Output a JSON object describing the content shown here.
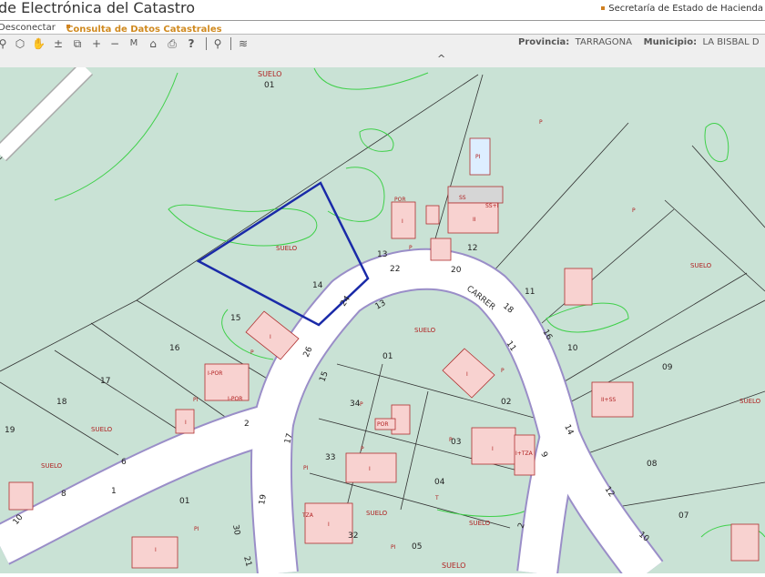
{
  "header": {
    "title": "de Electrónica del Catastro",
    "secretaria": "Secretaría de Estado de Hacienda"
  },
  "nav": {
    "disconnect": "Desconectar",
    "consulta": "Consulta de Datos Catastrales"
  },
  "toolbar": {
    "tools": [
      "zoom-icon",
      "layers-3d-icon",
      "pan-hand-icon",
      "zoom-plus-minus-icon",
      "zoom-window-icon",
      "zoom-in-icon",
      "zoom-out-icon",
      "measure-icon",
      "home-icon",
      "print-icon",
      "help-icon",
      "location-pin-icon",
      "layers-icon"
    ],
    "tool_glyphs": [
      "⚲",
      "⬡",
      "✋",
      "±",
      "⧉",
      "+",
      "−",
      "M",
      "⌂",
      "⎙",
      "?",
      "⚲",
      "≋"
    ],
    "provincia_label": "Provincia:",
    "provincia": "TARRAGONA",
    "municipio_label": "Municipio:",
    "municipio": "LA BISBAL D",
    "collapse": "^"
  },
  "map": {
    "street": "CARRER",
    "parcels": [
      "01",
      "13",
      "12",
      "14",
      "15",
      "16",
      "17",
      "18",
      "19",
      "11",
      "10",
      "09",
      "08",
      "07",
      "01",
      "34",
      "02",
      "33",
      "03",
      "04",
      "05",
      "01",
      "32"
    ],
    "suelo": [
      "SUELO",
      "SUELO",
      "SUELO",
      "SUELO",
      "SUELO",
      "SUELO",
      "SUELO",
      "SUELO",
      "SUELO",
      "SUELO"
    ],
    "house_numbers": [
      "22",
      "20",
      "24",
      "13",
      "18",
      "26",
      "15",
      "11",
      "16",
      "2",
      "6",
      "17",
      "14",
      "8",
      "1",
      "19",
      "9",
      "12",
      "30",
      "21",
      "10",
      "2",
      "10"
    ],
    "building_codes": [
      "I",
      "I",
      "I",
      "I",
      "I",
      "I",
      "I",
      "I",
      "POR",
      "POR",
      "SS",
      "SS+I",
      "II",
      "I-POR",
      "I-POR",
      "POR",
      "I+TZA",
      "II+SS",
      "TZA",
      "PI",
      "PI",
      "PI",
      "PI",
      "PI",
      "T",
      "P",
      "P",
      "P",
      "P",
      "P",
      "P",
      "P",
      "P"
    ]
  }
}
